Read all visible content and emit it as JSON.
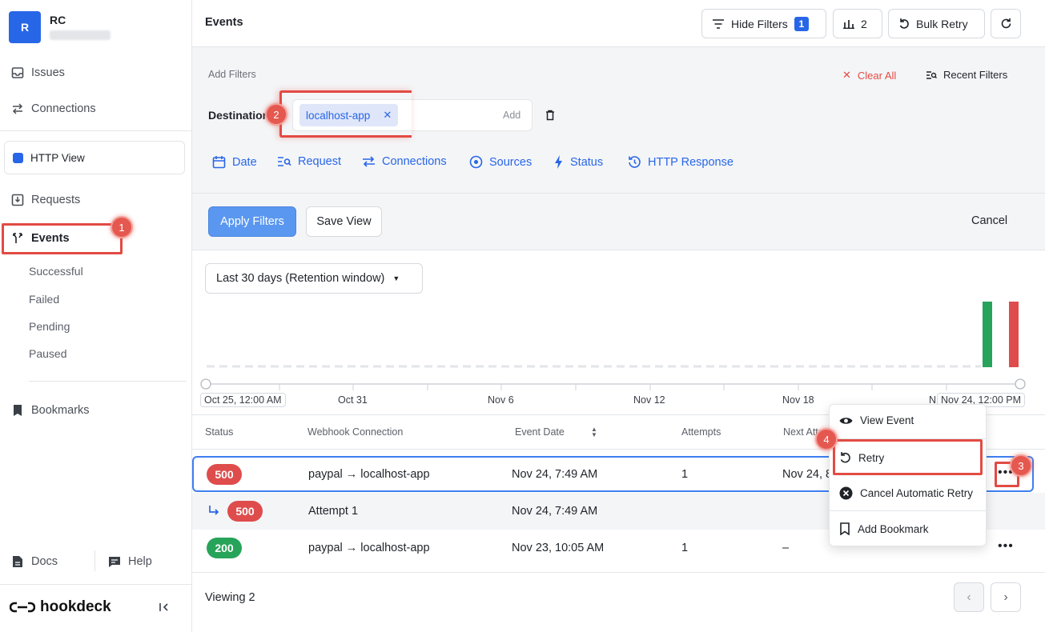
{
  "user": {
    "initial": "R",
    "name": "RC"
  },
  "sidebar": {
    "items": [
      {
        "label": "Issues"
      },
      {
        "label": "Connections"
      },
      {
        "label": "HTTP View"
      },
      {
        "label": "Requests"
      },
      {
        "label": "Events"
      },
      {
        "label": "Bookmarks"
      }
    ],
    "event_subitems": [
      "Successful",
      "Failed",
      "Pending",
      "Paused"
    ],
    "docs": "Docs",
    "help": "Help",
    "brand": "hookdeck"
  },
  "header": {
    "title": "Events",
    "hide_filters": "Hide Filters",
    "filter_count": "1",
    "chart_count": "2",
    "bulk_retry": "Bulk Retry"
  },
  "filters": {
    "add_filters": "Add Filters",
    "clear_all": "Clear All",
    "recent_filters": "Recent Filters",
    "destination_label": "Destination",
    "destination_chip": "localhost-app",
    "add_placeholder": "Add",
    "types": [
      "Date",
      "Request",
      "Connections",
      "Sources",
      "Status",
      "HTTP Response"
    ],
    "apply": "Apply Filters",
    "save_view": "Save View",
    "cancel": "Cancel"
  },
  "histogram": {
    "range": "Last 30 days (Retention window)",
    "ticks": [
      "Oct 25, 12:00 AM",
      "Oct 31",
      "Nov 6",
      "Nov 12",
      "Nov 18",
      "N",
      "Nov 24, 12:00 PM"
    ],
    "colors": {
      "success": "#27a35a",
      "failure": "#df4c4c"
    }
  },
  "table": {
    "columns": [
      "Status",
      "Webhook Connection",
      "Event Date",
      "Attempts",
      "Next Atte"
    ],
    "rows": [
      {
        "status": "500",
        "connection": "paypal → localhost-app",
        "date": "Nov 24, 7:49 AM",
        "attempts": "1",
        "next": "Nov 24, 8"
      },
      {
        "status": "500",
        "connection": "Attempt 1",
        "date": "Nov 24, 7:49 AM",
        "attempts": "",
        "next": ""
      },
      {
        "status": "200",
        "connection": "paypal → localhost-app",
        "date": "Nov 23, 10:05 AM",
        "attempts": "1",
        "next": "–"
      }
    ],
    "viewing": "Viewing 2"
  },
  "menu": {
    "items": [
      "View Event",
      "Retry",
      "Cancel Automatic Retry",
      "Add Bookmark"
    ]
  },
  "annotations": [
    "1",
    "2",
    "3",
    "4"
  ]
}
